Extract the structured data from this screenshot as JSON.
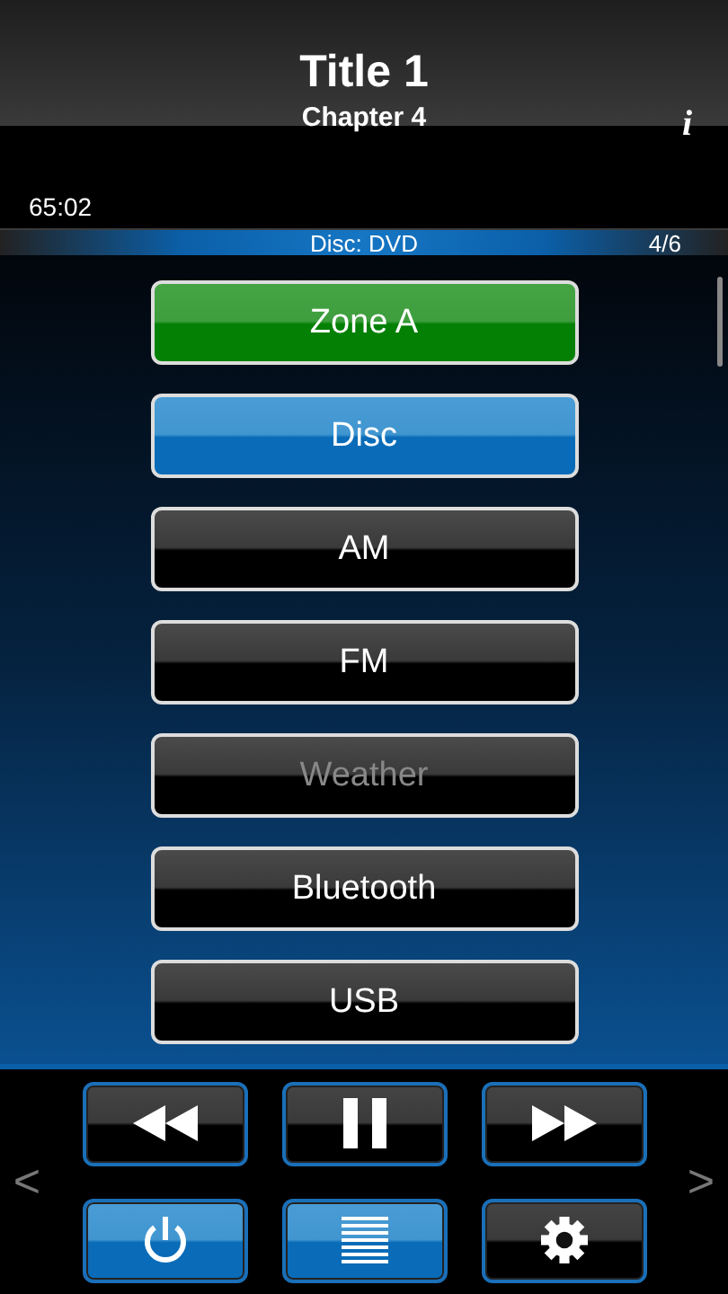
{
  "header": {
    "title": "Title 1",
    "subtitle": "Chapter 4",
    "info": "i"
  },
  "elapsed": "65:02",
  "source_bar": {
    "label": "Disc: DVD",
    "position": "4/6"
  },
  "sources": [
    {
      "label": "Zone A",
      "kind": "zone",
      "selected": false,
      "disabled": false
    },
    {
      "label": "Disc",
      "kind": "source",
      "selected": true,
      "disabled": false
    },
    {
      "label": "AM",
      "kind": "source",
      "selected": false,
      "disabled": false
    },
    {
      "label": "FM",
      "kind": "source",
      "selected": false,
      "disabled": false
    },
    {
      "label": "Weather",
      "kind": "source",
      "selected": false,
      "disabled": true
    },
    {
      "label": "Bluetooth",
      "kind": "source",
      "selected": false,
      "disabled": false
    },
    {
      "label": "USB",
      "kind": "source",
      "selected": false,
      "disabled": false
    }
  ],
  "controls": [
    {
      "kind": "rewind",
      "on": false
    },
    {
      "kind": "pause",
      "on": false
    },
    {
      "kind": "forward",
      "on": false
    },
    {
      "kind": "power",
      "on": true
    },
    {
      "kind": "menu",
      "on": true
    },
    {
      "kind": "settings",
      "on": false
    }
  ],
  "pager": {
    "previous": "<",
    "next": ">"
  }
}
